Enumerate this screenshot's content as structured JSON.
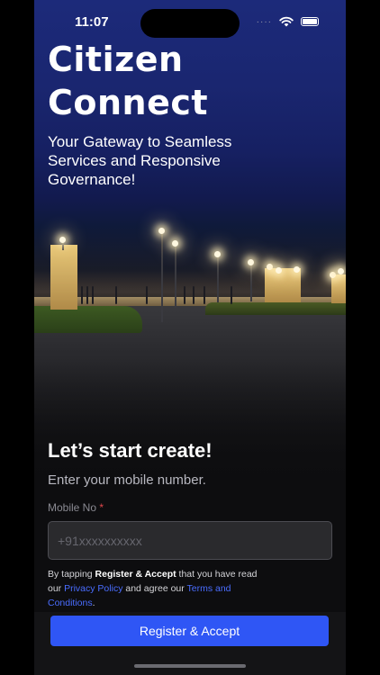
{
  "status_bar": {
    "time": "11:07",
    "signal": "····"
  },
  "hero": {
    "title_line1": "Citizen",
    "title_line2": "Connect",
    "subtitle": "Your Gateway to Seamless Services and Responsive Governance!"
  },
  "form": {
    "headline": "Let’s start create!",
    "instruction": "Enter your mobile number.",
    "mobile_label": "Mobile No",
    "required_marker": "*",
    "mobile_placeholder": "+91xxxxxxxxxx",
    "mobile_value": ""
  },
  "consent": {
    "part1": "By tapping ",
    "action_name": "Register & Accept",
    "part2": " that you have read our ",
    "privacy_link": "Privacy Policy",
    "part3": " and agree our ",
    "terms_link": "Terms and Conditions",
    "part4": "."
  },
  "footer": {
    "register_button": "Register & Accept"
  },
  "colors": {
    "accent": "#2f56f5",
    "link": "#4a6dff",
    "required": "#e0474c",
    "background": "#0d0d0f"
  },
  "icons": [
    "wifi-icon",
    "battery-icon",
    "cellular-signal-icon"
  ]
}
